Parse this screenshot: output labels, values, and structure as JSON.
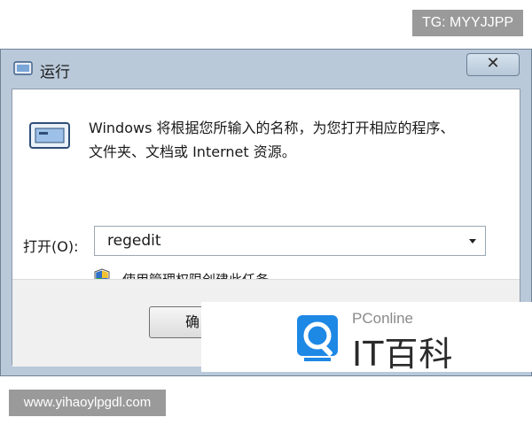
{
  "watermarks": {
    "top_right": "TG: MYYJJPP",
    "bottom_left": "www.yihaoylpgdl.com",
    "pconline_label": "PConline",
    "pconline_title": "IT百科"
  },
  "dialog": {
    "title": "运行",
    "close_glyph": "✕",
    "description_line1": "Windows 将根据您所输入的名称，为您打开相应的程序、",
    "description_line2": "文件夹、文档或 Internet 资源。",
    "open_label": "打开(O):",
    "open_value": "regedit",
    "admin_note": "使用管理权限创建此任务。",
    "ok_button": "确"
  },
  "colors": {
    "titlebar": "#b9c9da",
    "shield_blue": "#2f6fc8",
    "shield_green": "#3aa14a",
    "logo_blue": "#1e88e5"
  }
}
